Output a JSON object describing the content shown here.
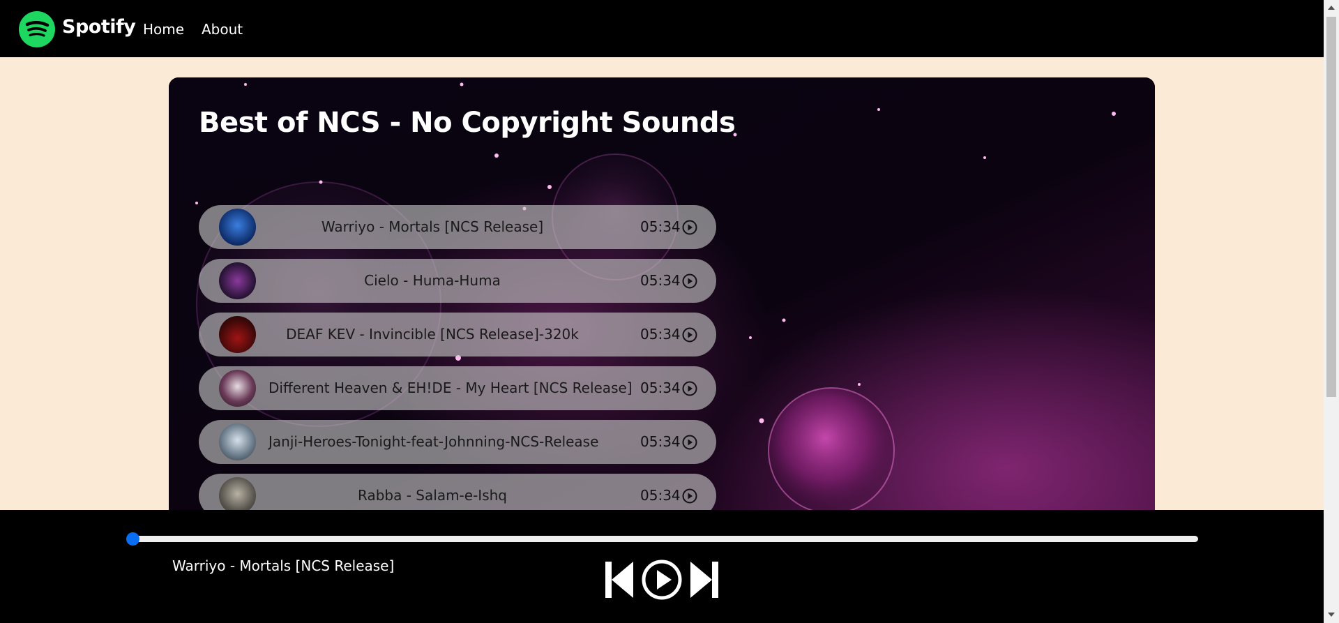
{
  "navbar": {
    "brand": "Spotify",
    "links": [
      {
        "label": "Home"
      },
      {
        "label": "About"
      }
    ]
  },
  "main": {
    "title": "Best of NCS - No Copyright Sounds",
    "songs": [
      {
        "name": "Warriyo - Mortals [NCS Release]",
        "duration": "05:34",
        "cover_color": "#123a8a"
      },
      {
        "name": "Cielo - Huma-Huma",
        "duration": "05:34",
        "cover_color": "#2a1438"
      },
      {
        "name": "DEAF KEV - Invincible [NCS Release]-320k",
        "duration": "05:34",
        "cover_color": "#3a0808"
      },
      {
        "name": "Different Heaven & EH!DE - My Heart [NCS Release]",
        "duration": "05:34",
        "cover_color": "#1d1418"
      },
      {
        "name": "Janji-Heroes-Tonight-feat-Johnning-NCS-Release",
        "duration": "05:34",
        "cover_color": "#6f7f8e"
      },
      {
        "name": "Rabba - Salam-e-Ishq",
        "duration": "05:34",
        "cover_color": "#5a5650"
      }
    ]
  },
  "player": {
    "now_playing": "Warriyo - Mortals [NCS Release]",
    "progress": 0,
    "accent_color": "#0a6ef5"
  },
  "icons": {
    "logo": "spotify-logo-icon",
    "song_play": "play-circle-icon",
    "prev": "skip-previous-icon",
    "play": "play-circle-icon",
    "next": "skip-next-icon"
  }
}
